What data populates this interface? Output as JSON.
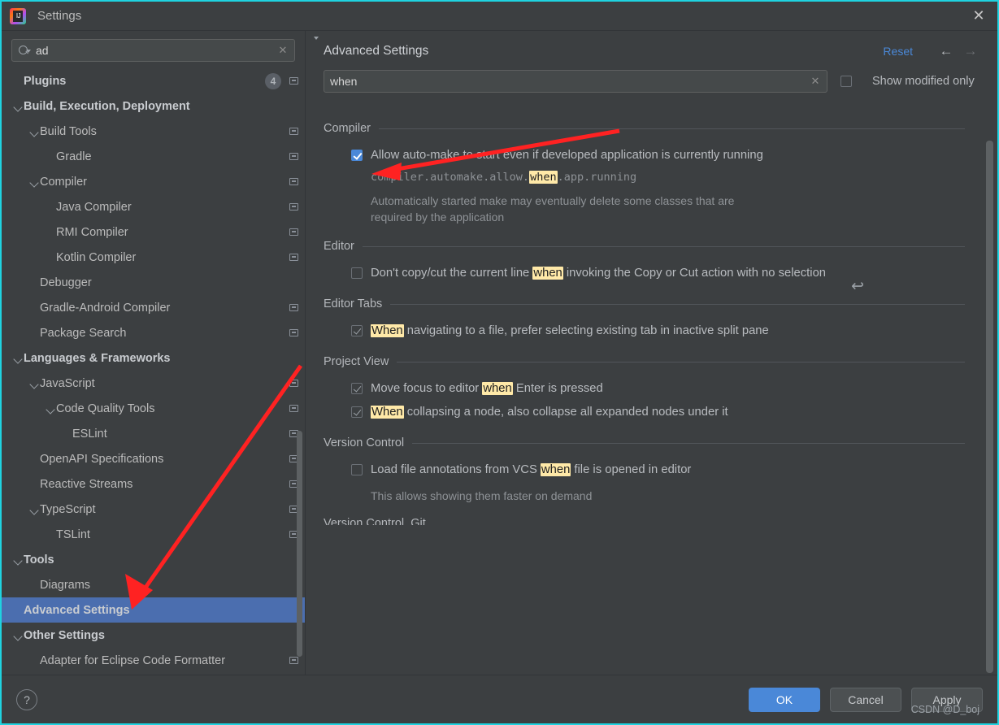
{
  "window": {
    "title": "Settings",
    "logo_icon": "intellij-idea-logo",
    "close_icon": "close-icon",
    "accent_border": "#1fd3e0"
  },
  "sidebar": {
    "search": {
      "value": "ad",
      "placeholder": "",
      "icon": "search-icon",
      "clear_icon": "clear-icon"
    },
    "items": [
      {
        "label": "Plugins",
        "indent": 0,
        "bold": true,
        "expander": "none",
        "badge": "4",
        "mini_icon": true,
        "selected": false
      },
      {
        "label": "Build, Execution, Deployment",
        "indent": 0,
        "bold": true,
        "expander": "open",
        "mini_icon": false,
        "selected": false
      },
      {
        "label": "Build Tools",
        "indent": 1,
        "bold": false,
        "expander": "open",
        "mini_icon": true,
        "selected": false
      },
      {
        "label": "Gradle",
        "indent": 2,
        "bold": false,
        "expander": "none",
        "mini_icon": true,
        "selected": false
      },
      {
        "label": "Compiler",
        "indent": 1,
        "bold": false,
        "expander": "open",
        "mini_icon": true,
        "selected": false
      },
      {
        "label": "Java Compiler",
        "indent": 2,
        "bold": false,
        "expander": "none",
        "mini_icon": true,
        "selected": false
      },
      {
        "label": "RMI Compiler",
        "indent": 2,
        "bold": false,
        "expander": "none",
        "mini_icon": true,
        "selected": false
      },
      {
        "label": "Kotlin Compiler",
        "indent": 2,
        "bold": false,
        "expander": "none",
        "mini_icon": true,
        "selected": false
      },
      {
        "label": "Debugger",
        "indent": 1,
        "bold": false,
        "expander": "none",
        "mini_icon": false,
        "selected": false
      },
      {
        "label": "Gradle-Android Compiler",
        "indent": 1,
        "bold": false,
        "expander": "none",
        "mini_icon": true,
        "selected": false
      },
      {
        "label": "Package Search",
        "indent": 1,
        "bold": false,
        "expander": "none",
        "mini_icon": true,
        "selected": false
      },
      {
        "label": "Languages & Frameworks",
        "indent": 0,
        "bold": true,
        "expander": "open",
        "mini_icon": false,
        "selected": false
      },
      {
        "label": "JavaScript",
        "indent": 1,
        "bold": false,
        "expander": "open",
        "mini_icon": true,
        "selected": false
      },
      {
        "label": "Code Quality Tools",
        "indent": 2,
        "bold": false,
        "expander": "open",
        "mini_icon": true,
        "selected": false
      },
      {
        "label": "ESLint",
        "indent": 3,
        "bold": false,
        "expander": "none",
        "mini_icon": true,
        "selected": false
      },
      {
        "label": "OpenAPI Specifications",
        "indent": 1,
        "bold": false,
        "expander": "none",
        "mini_icon": true,
        "selected": false
      },
      {
        "label": "Reactive Streams",
        "indent": 1,
        "bold": false,
        "expander": "none",
        "mini_icon": true,
        "selected": false
      },
      {
        "label": "TypeScript",
        "indent": 1,
        "bold": false,
        "expander": "open",
        "mini_icon": true,
        "selected": false
      },
      {
        "label": "TSLint",
        "indent": 2,
        "bold": false,
        "expander": "none",
        "mini_icon": true,
        "selected": false
      },
      {
        "label": "Tools",
        "indent": 0,
        "bold": true,
        "expander": "open",
        "mini_icon": false,
        "selected": false
      },
      {
        "label": "Diagrams",
        "indent": 1,
        "bold": false,
        "expander": "none",
        "mini_icon": false,
        "selected": false
      },
      {
        "label": "Advanced Settings",
        "indent": 0,
        "bold": true,
        "expander": "none",
        "mini_icon": false,
        "selected": true
      },
      {
        "label": "Other Settings",
        "indent": 0,
        "bold": true,
        "expander": "open",
        "mini_icon": false,
        "selected": false
      },
      {
        "label": "Adapter for Eclipse Code Formatter",
        "indent": 1,
        "bold": false,
        "expander": "none",
        "mini_icon": true,
        "selected": false
      }
    ]
  },
  "main": {
    "page_title": "Advanced Settings",
    "reset_label": "Reset",
    "back_icon": "arrow-left-icon",
    "forward_icon": "arrow-right-icon",
    "filter": {
      "value": "when",
      "placeholder": "",
      "icon": "search-icon",
      "clear_icon": "clear-icon"
    },
    "show_modified_only": {
      "label": "Show modified only",
      "checked": false
    },
    "revert_icon": "revert-arrow-icon",
    "groups": [
      {
        "title": "Compiler",
        "options": [
          {
            "checked": true,
            "enabled": true,
            "text_before": "Allow auto-make to start even if developed application is currently running",
            "highlight": "",
            "text_after": "",
            "key_before": "compiler.automake.allow.",
            "key_highlight": "when",
            "key_after": ".app.running",
            "description": "Automatically started make may eventually delete some classes that are required by the application",
            "has_revert": true
          }
        ]
      },
      {
        "title": "Editor",
        "options": [
          {
            "checked": false,
            "enabled": true,
            "text_before": "Don't copy/cut the current line ",
            "highlight": "when",
            "text_after": " invoking the Copy or Cut action with no selection",
            "key_before": "",
            "key_highlight": "",
            "key_after": "",
            "description": "",
            "has_revert": false
          }
        ]
      },
      {
        "title": "Editor Tabs",
        "options": [
          {
            "checked": true,
            "enabled": false,
            "text_before": "",
            "highlight": "When",
            "text_after": " navigating to a file, prefer selecting existing tab in inactive split pane",
            "key_before": "",
            "key_highlight": "",
            "key_after": "",
            "description": "",
            "has_revert": false
          }
        ]
      },
      {
        "title": "Project View",
        "options": [
          {
            "checked": true,
            "enabled": false,
            "text_before": "Move focus to editor ",
            "highlight": "when",
            "text_after": " Enter is pressed",
            "key_before": "",
            "key_highlight": "",
            "key_after": "",
            "description": "",
            "has_revert": false
          },
          {
            "checked": true,
            "enabled": false,
            "text_before": "",
            "highlight": "When",
            "text_after": " collapsing a node, also collapse all expanded nodes under it",
            "key_before": "",
            "key_highlight": "",
            "key_after": "",
            "description": "",
            "has_revert": false
          }
        ]
      },
      {
        "title": "Version Control",
        "options": [
          {
            "checked": false,
            "enabled": true,
            "text_before": "Load file annotations from VCS ",
            "highlight": "when",
            "text_after": " file is opened in editor",
            "key_before": "",
            "key_highlight": "",
            "key_after": "",
            "description": "This allows showing them faster on demand",
            "has_revert": false
          }
        ]
      }
    ],
    "cut_off_group_title": "Version Control. Git"
  },
  "footer": {
    "help_label": "?",
    "ok_label": "OK",
    "cancel_label": "Cancel",
    "apply_label": "Apply",
    "watermark": "CSDN @D_boj"
  }
}
